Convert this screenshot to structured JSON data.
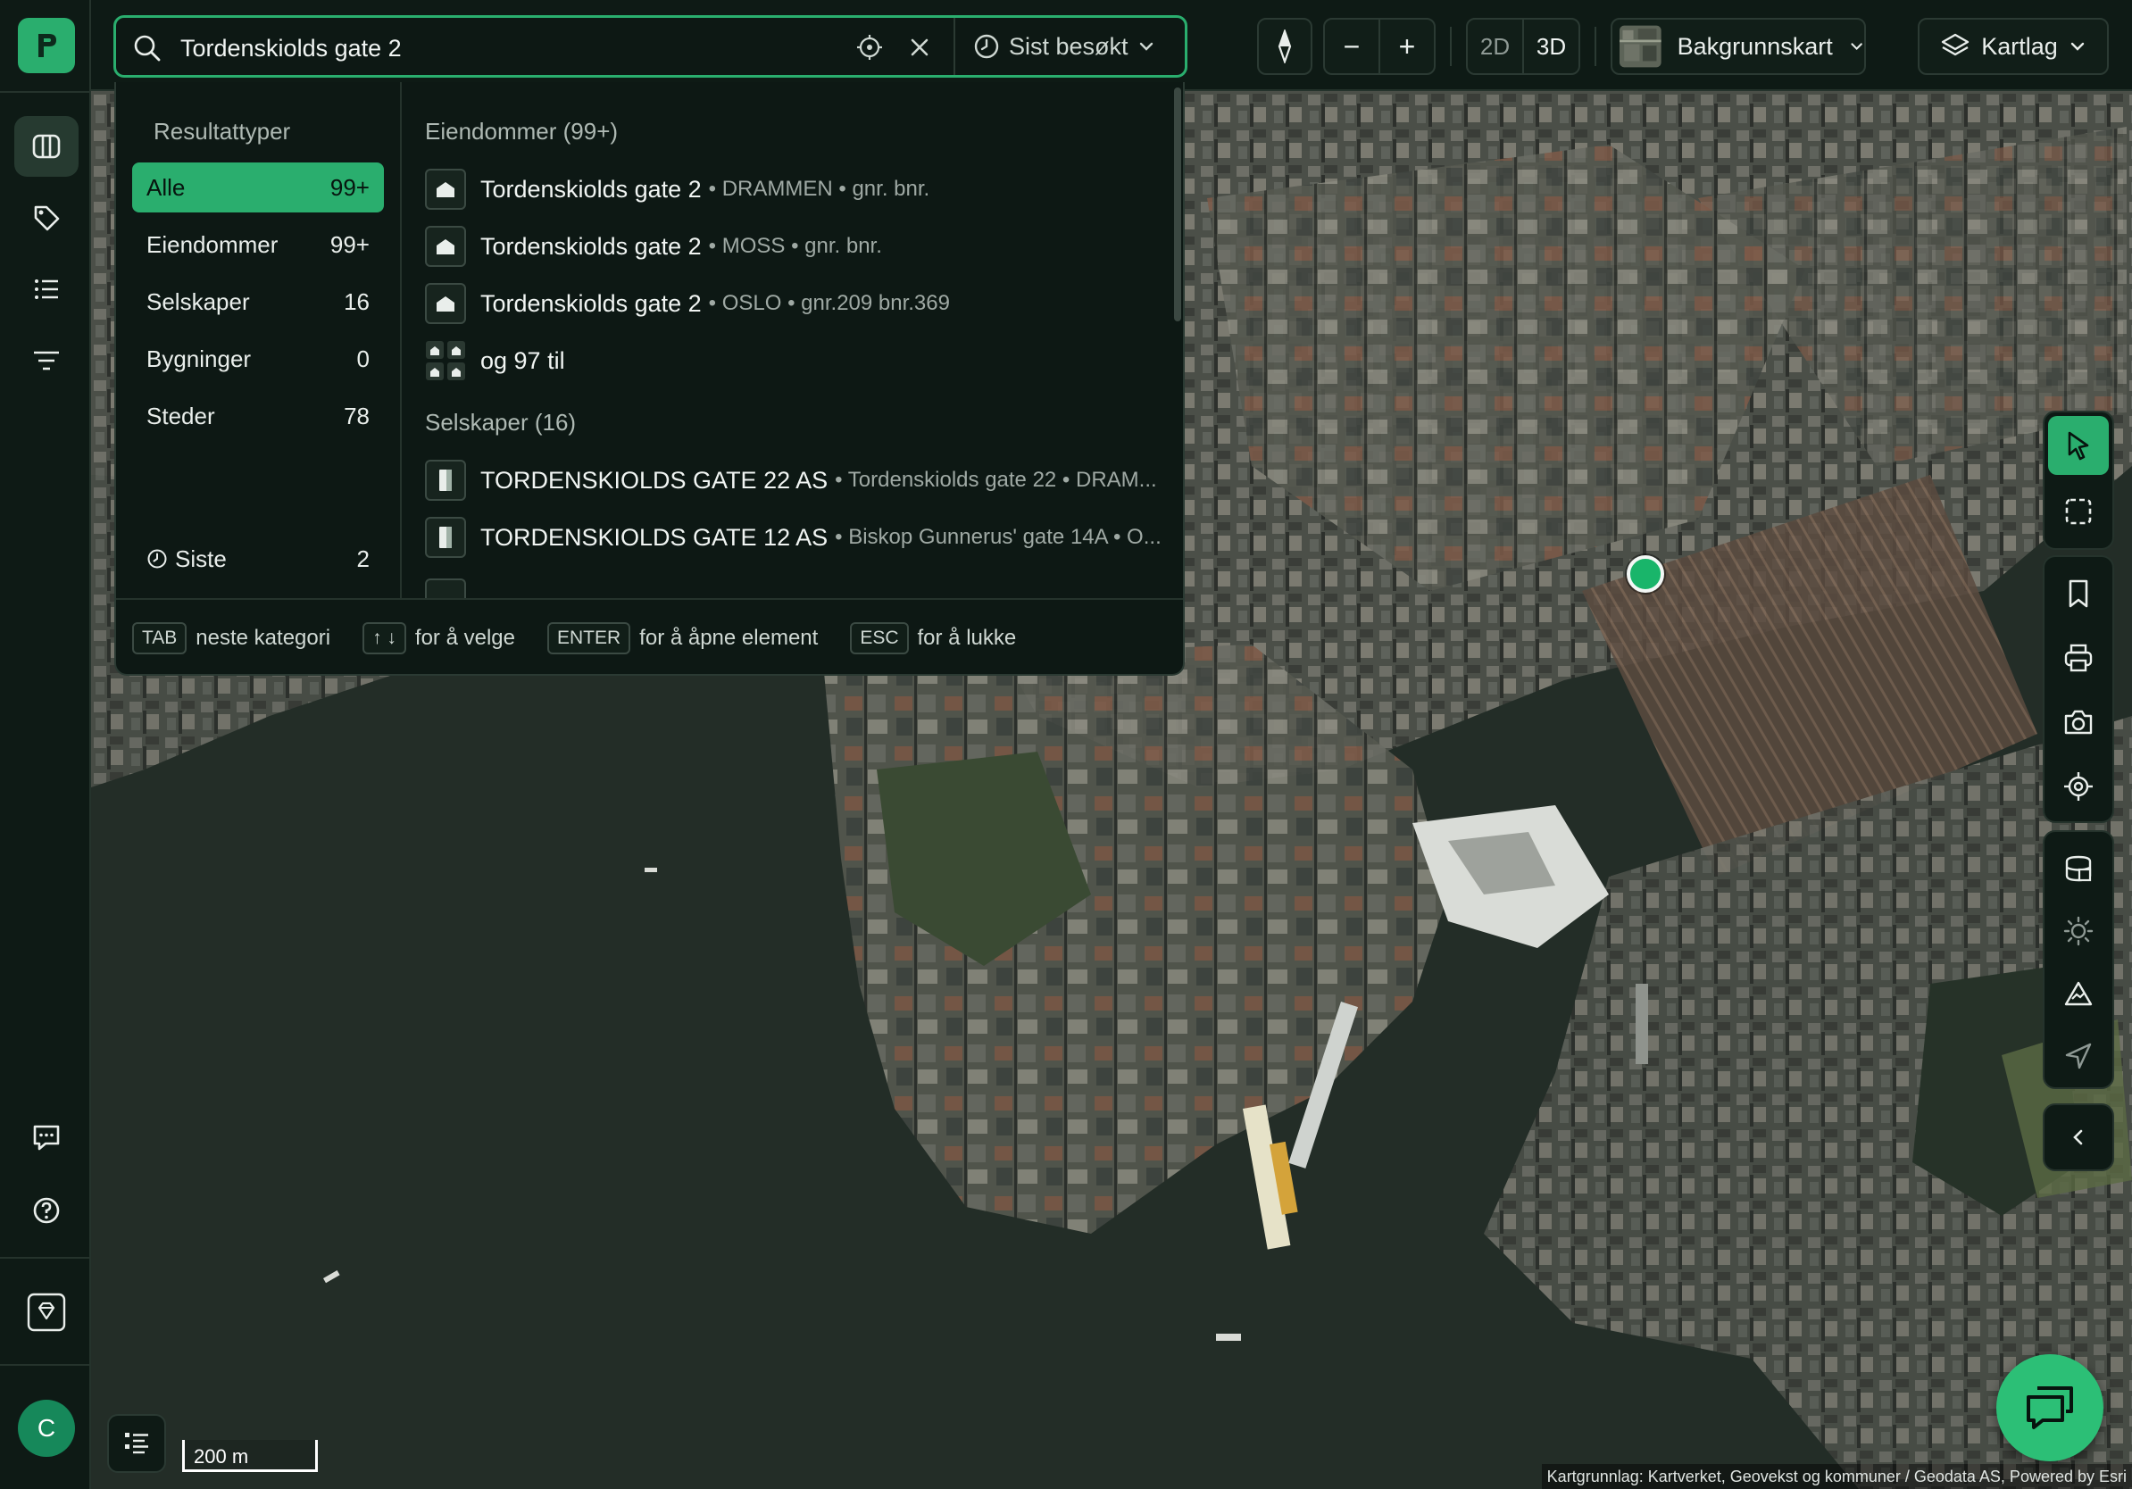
{
  "search": {
    "query": "Tordenskiolds gate 2",
    "recent_label": "Sist besøkt"
  },
  "toolbar": {
    "zoom_out": "−",
    "zoom_in": "+",
    "view_2d": "2D",
    "view_3d": "3D",
    "basemap_label": "Bakgrunnskart",
    "layers_label": "Kartlag"
  },
  "result_types": {
    "heading": "Resultattyper",
    "items": [
      {
        "label": "Alle",
        "count": "99+"
      },
      {
        "label": "Eiendommer",
        "count": "99+"
      },
      {
        "label": "Selskaper",
        "count": "16"
      },
      {
        "label": "Bygninger",
        "count": "0"
      },
      {
        "label": "Steder",
        "count": "78"
      }
    ],
    "recent": {
      "label": "Siste",
      "count": "2"
    }
  },
  "results": {
    "properties_heading": "Eiendommer (99+)",
    "properties": [
      {
        "title": "Tordenskiolds gate 2",
        "sub": "• DRAMMEN • gnr. bnr."
      },
      {
        "title": "Tordenskiolds gate 2",
        "sub": "• MOSS • gnr. bnr."
      },
      {
        "title": "Tordenskiolds gate 2",
        "sub": "• OSLO • gnr.209 bnr.369"
      }
    ],
    "more_label": "og 97 til",
    "companies_heading": "Selskaper (16)",
    "companies": [
      {
        "title": "TORDENSKIOLDS GATE 22 AS",
        "sub": "• Tordenskiolds gate 22 • DRAM..."
      },
      {
        "title": "TORDENSKIOLDS GATE 12 AS",
        "sub": "• Biskop Gunnerus' gate 14A • O..."
      }
    ]
  },
  "shortcuts": [
    {
      "key": "TAB",
      "text": "neste kategori"
    },
    {
      "key": "↑ ↓",
      "text": "for å velge"
    },
    {
      "key": "ENTER",
      "text": "for å åpne element"
    },
    {
      "key": "ESC",
      "text": "for å lukke"
    }
  ],
  "map": {
    "scale_label": "200 m",
    "attribution": "Kartgrunnlag: Kartverket, Geovekst og kommuner / Geodata AS, Powered by Esri"
  },
  "user": {
    "avatar_initial": "C"
  },
  "colors": {
    "accent": "#2aae6e",
    "panel": "#0e1a15",
    "water": "#1f2a24"
  }
}
